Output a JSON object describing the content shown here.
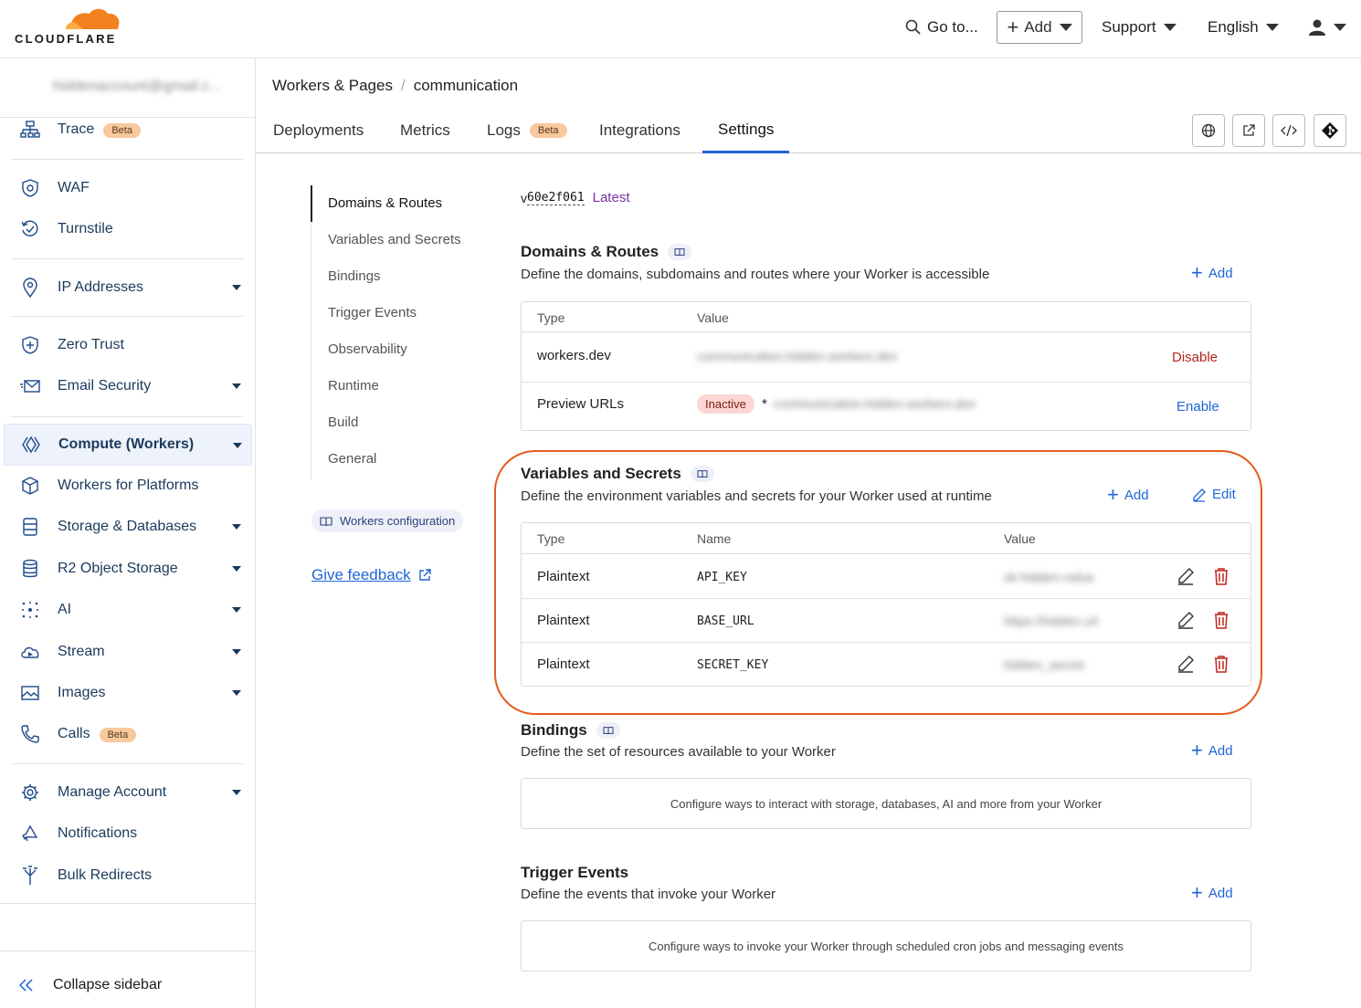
{
  "topbar": {
    "logo_text": "CLOUDFLARE",
    "goto_label": "Go to...",
    "add_label": "Add",
    "support_label": "Support",
    "language_label": "English"
  },
  "sidebar": {
    "account": "hiddenaccount@gmail.c...",
    "items": [
      {
        "label": "Trace",
        "badge": "Beta",
        "icon": "trace-icon"
      },
      {
        "label": "WAF",
        "icon": "waf-icon"
      },
      {
        "label": "Turnstile",
        "icon": "turnstile-icon"
      },
      {
        "label": "IP Addresses",
        "icon": "location-pin-icon"
      },
      {
        "label": "Zero Trust",
        "icon": "zero-trust-icon"
      },
      {
        "label": "Email Security",
        "icon": "envelope-icon"
      },
      {
        "label": "Compute (Workers)",
        "icon": "workers-icon"
      },
      {
        "label": "Workers for Platforms",
        "icon": "cube-icon"
      },
      {
        "label": "Storage & Databases",
        "icon": "storage-icon"
      },
      {
        "label": "R2 Object Storage",
        "icon": "database-icon"
      },
      {
        "label": "AI",
        "icon": "sparkle-icon"
      },
      {
        "label": "Stream",
        "icon": "cloud-play-icon"
      },
      {
        "label": "Images",
        "icon": "image-icon"
      },
      {
        "label": "Calls",
        "badge": "Beta",
        "icon": "phone-icon"
      },
      {
        "label": "Manage Account",
        "icon": "gear-icon"
      },
      {
        "label": "Notifications",
        "icon": "megaphone-icon"
      },
      {
        "label": "Bulk Redirects",
        "icon": "redirect-icon"
      }
    ],
    "collapse_label": "Collapse sidebar"
  },
  "breadcrumb": {
    "parent": "Workers & Pages",
    "current": "communication"
  },
  "tabs": [
    {
      "label": "Deployments"
    },
    {
      "label": "Metrics"
    },
    {
      "label": "Logs",
      "badge": "Beta"
    },
    {
      "label": "Integrations"
    },
    {
      "label": "Settings"
    }
  ],
  "settings_nav": {
    "items": [
      "Domains & Routes",
      "Variables and Secrets",
      "Bindings",
      "Trigger Events",
      "Observability",
      "Runtime",
      "Build",
      "General"
    ],
    "config_pill": "Workers configuration",
    "feedback": "Give feedback"
  },
  "version": {
    "prefix": "v",
    "hash": "60e2f061",
    "status": "Latest"
  },
  "domains": {
    "title": "Domains & Routes",
    "desc": "Define the domains, subdomains and routes where your Worker is accessible",
    "add": "Add",
    "headers": {
      "type": "Type",
      "value": "Value"
    },
    "rows": [
      {
        "type": "workers.dev",
        "value": "communication.hidden.workers.dev",
        "action": "Disable"
      },
      {
        "type": "Preview URLs",
        "status": "Inactive",
        "prefix": "*",
        "value": "-communication.hidden.workers.dev",
        "action": "Enable"
      }
    ]
  },
  "variables": {
    "title": "Variables and Secrets",
    "desc": "Define the environment variables and secrets for your Worker used at runtime",
    "add": "Add",
    "edit": "Edit",
    "headers": {
      "type": "Type",
      "name": "Name",
      "value": "Value"
    },
    "rows": [
      {
        "type": "Plaintext",
        "name": "API_KEY",
        "value": "sk-hidden-value"
      },
      {
        "type": "Plaintext",
        "name": "BASE_URL",
        "value": "https://hidden.url"
      },
      {
        "type": "Plaintext",
        "name": "SECRET_KEY",
        "value": "hidden_secret"
      }
    ]
  },
  "bindings": {
    "title": "Bindings",
    "desc": "Define the set of resources available to your Worker",
    "add": "Add",
    "empty": "Configure ways to interact with storage, databases, AI and more from your Worker"
  },
  "triggers": {
    "title": "Trigger Events",
    "desc": "Define the events that invoke your Worker",
    "add": "Add",
    "empty": "Configure ways to invoke your Worker through scheduled cron jobs and messaging events"
  },
  "colors": {
    "accent": "#1f65d6",
    "highlight": "#e35b1f",
    "danger": "#c0271a",
    "brand": "#f48120"
  }
}
